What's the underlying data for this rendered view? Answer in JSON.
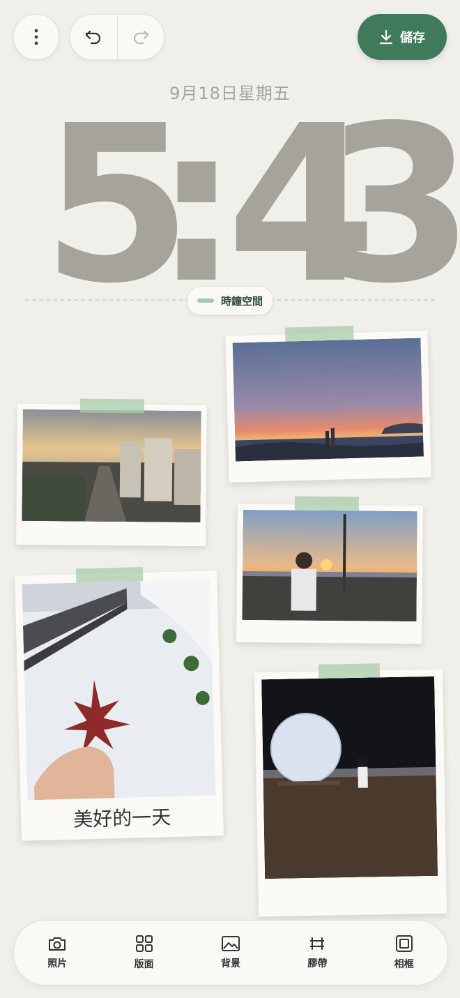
{
  "toolbar": {
    "more_icon": "more-vertical-icon",
    "undo_icon": "undo-icon",
    "redo_icon": "redo-icon",
    "save_label": "儲存",
    "save_icon": "download-icon",
    "save_color": "#3f7a5a"
  },
  "clock": {
    "date": "9月18日星期五",
    "hour": "5",
    "colon": ":",
    "minute_tens": "4",
    "minute_ones": "3",
    "space_label": "時鐘空間"
  },
  "photos": [
    {
      "name": "sunset-beach-photo"
    },
    {
      "name": "city-sunset-photo"
    },
    {
      "name": "harbor-sunset-photo"
    },
    {
      "name": "snow-leaf-photo",
      "caption": "美好的一天"
    },
    {
      "name": "moon-night-photo"
    }
  ],
  "bottom_tools": [
    {
      "label": "照片",
      "icon": "camera-icon"
    },
    {
      "label": "版面",
      "icon": "layout-grid-icon"
    },
    {
      "label": "背景",
      "icon": "image-icon"
    },
    {
      "label": "膠帶",
      "icon": "tape-icon"
    },
    {
      "label": "相框",
      "icon": "frame-icon"
    }
  ]
}
